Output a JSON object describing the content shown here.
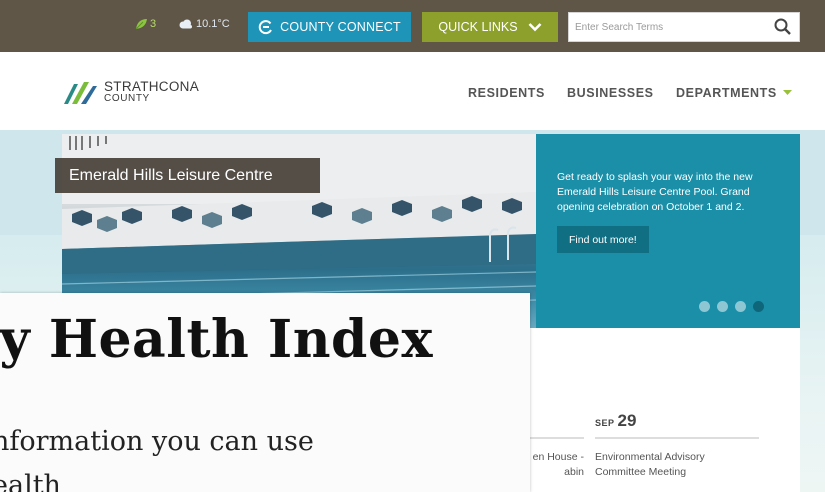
{
  "topbar": {
    "aqhi_value": "3",
    "temperature": "10.1°C",
    "county_connect_label": "COUNTY CONNECT",
    "quick_links_label": "QUICK LINKS",
    "search": {
      "placeholder": "Enter Search Terms",
      "value": ""
    }
  },
  "logo": {
    "line1": "STRATHCONA",
    "line2": "COUNTY"
  },
  "nav": {
    "items": [
      {
        "label": "RESIDENTS"
      },
      {
        "label": "BUSINESSES"
      },
      {
        "label": "DEPARTMENTS"
      }
    ]
  },
  "hero": {
    "caption": "Emerald Hills Leisure Centre",
    "promo_text": "Get ready to splash your way into the new Emerald Hills Leisure Centre Pool. Grand opening celebration on October 1 and 2.",
    "promo_button": "Find out more!",
    "slides_total": 4,
    "active_slide": 4
  },
  "events": {
    "prev_title": "en House - abin",
    "items": [
      {
        "month": "SEP",
        "day": "29",
        "title": "Environmental Advisory Committee Meeting"
      }
    ]
  },
  "overlay": {
    "title": "ty Health Index",
    "line1": "nformation you can use",
    "line2": "ealth"
  },
  "colors": {
    "topbar": "#5f5647",
    "county_connect": "#1e94b8",
    "quick_links": "#8ea02c",
    "promo": "#1b8fa8"
  }
}
